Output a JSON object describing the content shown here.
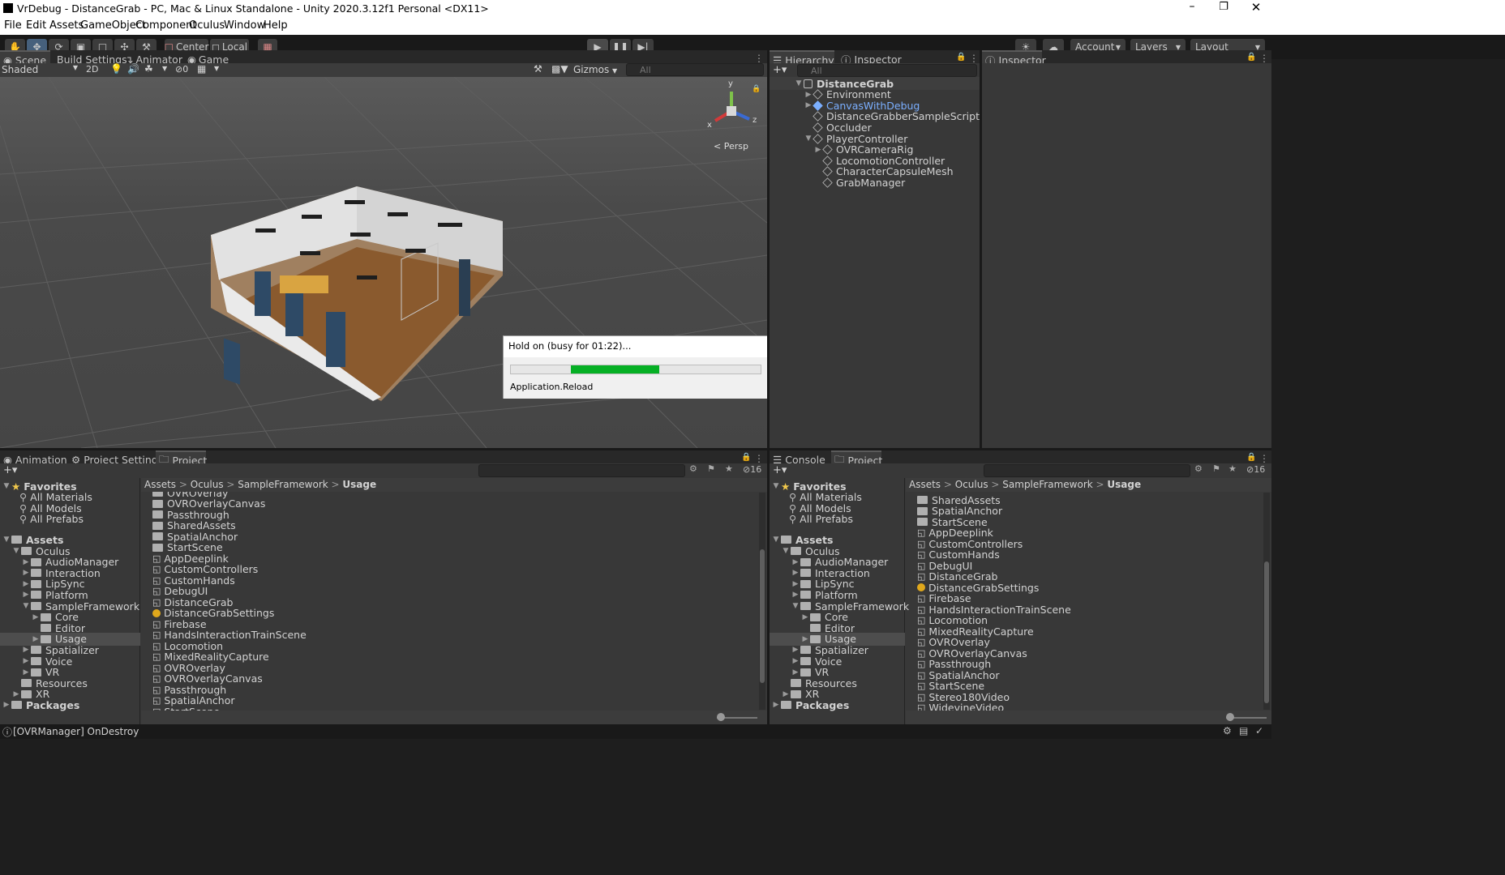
{
  "window": {
    "title": "VrDebug - DistanceGrab - PC, Mac & Linux Standalone - Unity 2020.3.12f1 Personal <DX11>"
  },
  "menu": [
    "File",
    "Edit",
    "Assets",
    "GameObject",
    "Component",
    "Oculus",
    "Window",
    "Help"
  ],
  "toolbar": {
    "center": "Center",
    "local": "Local",
    "account": "Account",
    "layers": "Layers",
    "layout": "Layout"
  },
  "scene_tabs": [
    "Scene",
    "Build Settings",
    "Animator",
    "Game"
  ],
  "scene_bar": {
    "shading": "Shaded",
    "twoD": "2D",
    "hidden_count": "0",
    "gizmos": "Gizmos",
    "search_placeholder": "All"
  },
  "gizmo": {
    "y": "y",
    "x": "x",
    "z": "z",
    "persp": "< Persp"
  },
  "dialog": {
    "title": "Hold on (busy for 01:22)...",
    "status": "Application.Reload",
    "progress": 0.35
  },
  "hier_tabs": [
    "Hierarchy",
    "Inspector"
  ],
  "hier_search": "All",
  "hierarchy": [
    {
      "label": "DistanceGrab",
      "depth": 0,
      "arrow": "▼",
      "kind": "scene"
    },
    {
      "label": "Environment",
      "depth": 1,
      "arrow": "▶",
      "kind": "go"
    },
    {
      "label": "CanvasWithDebug",
      "depth": 1,
      "arrow": "▶",
      "kind": "prefab"
    },
    {
      "label": "DistanceGrabberSampleScript",
      "depth": 1,
      "arrow": "",
      "kind": "go"
    },
    {
      "label": "Occluder",
      "depth": 1,
      "arrow": "",
      "kind": "go"
    },
    {
      "label": "PlayerController",
      "depth": 1,
      "arrow": "▼",
      "kind": "go"
    },
    {
      "label": "OVRCameraRig",
      "depth": 2,
      "arrow": "▶",
      "kind": "go"
    },
    {
      "label": "LocomotionController",
      "depth": 2,
      "arrow": "",
      "kind": "go"
    },
    {
      "label": "CharacterCapsuleMesh",
      "depth": 2,
      "arrow": "",
      "kind": "go"
    },
    {
      "label": "GrabManager",
      "depth": 2,
      "arrow": "",
      "kind": "go"
    }
  ],
  "inspector_tab": "Inspector",
  "bottom_left_tabs": [
    "Animation",
    "Project Settings",
    "Project"
  ],
  "bottom_right_tabs": [
    "Console",
    "Project"
  ],
  "hidden_packages": "16",
  "favorites": {
    "title": "Favorites",
    "items": [
      "All Materials",
      "All Models",
      "All Prefabs"
    ]
  },
  "assets_tree": [
    {
      "label": "Assets",
      "depth": 0,
      "arrow": "▼",
      "bold": true
    },
    {
      "label": "Oculus",
      "depth": 1,
      "arrow": "▼"
    },
    {
      "label": "AudioManager",
      "depth": 2,
      "arrow": "▶"
    },
    {
      "label": "Interaction",
      "depth": 2,
      "arrow": "▶"
    },
    {
      "label": "LipSync",
      "depth": 2,
      "arrow": "▶"
    },
    {
      "label": "Platform",
      "depth": 2,
      "arrow": "▶"
    },
    {
      "label": "SampleFramework",
      "depth": 2,
      "arrow": "▼"
    },
    {
      "label": "Core",
      "depth": 3,
      "arrow": "▶"
    },
    {
      "label": "Editor",
      "depth": 3,
      "arrow": ""
    },
    {
      "label": "Usage",
      "depth": 3,
      "arrow": "▶",
      "selected": true
    },
    {
      "label": "Spatializer",
      "depth": 2,
      "arrow": "▶"
    },
    {
      "label": "Voice",
      "depth": 2,
      "arrow": "▶"
    },
    {
      "label": "VR",
      "depth": 2,
      "arrow": "▶"
    },
    {
      "label": "Resources",
      "depth": 1,
      "arrow": ""
    },
    {
      "label": "XR",
      "depth": 1,
      "arrow": "▶"
    },
    {
      "label": "Packages",
      "depth": 0,
      "arrow": "▶",
      "bold": true
    }
  ],
  "breadcrumb": [
    "Assets",
    "Oculus",
    "SampleFramework",
    "Usage"
  ],
  "files_left": [
    {
      "label": "OVROverlay",
      "kind": "folder"
    },
    {
      "label": "OVROverlayCanvas",
      "kind": "folder"
    },
    {
      "label": "Passthrough",
      "kind": "folder"
    },
    {
      "label": "SharedAssets",
      "kind": "folder"
    },
    {
      "label": "SpatialAnchor",
      "kind": "folder"
    },
    {
      "label": "StartScene",
      "kind": "folder"
    },
    {
      "label": "AppDeeplink",
      "kind": "scene"
    },
    {
      "label": "CustomControllers",
      "kind": "scene"
    },
    {
      "label": "CustomHands",
      "kind": "scene"
    },
    {
      "label": "DebugUI",
      "kind": "scene"
    },
    {
      "label": "DistanceGrab",
      "kind": "scene"
    },
    {
      "label": "DistanceGrabSettings",
      "kind": "settings"
    },
    {
      "label": "Firebase",
      "kind": "scene"
    },
    {
      "label": "HandsInteractionTrainScene",
      "kind": "scene"
    },
    {
      "label": "Locomotion",
      "kind": "scene"
    },
    {
      "label": "MixedRealityCapture",
      "kind": "scene"
    },
    {
      "label": "OVROverlay",
      "kind": "scene"
    },
    {
      "label": "OVROverlayCanvas",
      "kind": "scene"
    },
    {
      "label": "Passthrough",
      "kind": "scene"
    },
    {
      "label": "SpatialAnchor",
      "kind": "scene"
    },
    {
      "label": "StartScene",
      "kind": "scene"
    }
  ],
  "files_right": [
    {
      "label": "SharedAssets",
      "kind": "folder"
    },
    {
      "label": "SpatialAnchor",
      "kind": "folder"
    },
    {
      "label": "StartScene",
      "kind": "folder"
    },
    {
      "label": "AppDeeplink",
      "kind": "scene"
    },
    {
      "label": "CustomControllers",
      "kind": "scene"
    },
    {
      "label": "CustomHands",
      "kind": "scene"
    },
    {
      "label": "DebugUI",
      "kind": "scene"
    },
    {
      "label": "DistanceGrab",
      "kind": "scene"
    },
    {
      "label": "DistanceGrabSettings",
      "kind": "settings"
    },
    {
      "label": "Firebase",
      "kind": "scene"
    },
    {
      "label": "HandsInteractionTrainScene",
      "kind": "scene"
    },
    {
      "label": "Locomotion",
      "kind": "scene"
    },
    {
      "label": "MixedRealityCapture",
      "kind": "scene"
    },
    {
      "label": "OVROverlay",
      "kind": "scene"
    },
    {
      "label": "OVROverlayCanvas",
      "kind": "scene"
    },
    {
      "label": "Passthrough",
      "kind": "scene"
    },
    {
      "label": "SpatialAnchor",
      "kind": "scene"
    },
    {
      "label": "StartScene",
      "kind": "scene"
    },
    {
      "label": "Stereo180Video",
      "kind": "scene"
    },
    {
      "label": "WidevineVideo",
      "kind": "scene"
    }
  ],
  "status_bar": {
    "message": "[OVRManager] OnDestroy"
  },
  "colors": {
    "prefab": "#7bafff",
    "progress": "#06b025",
    "accent": "#4d4d4d"
  }
}
